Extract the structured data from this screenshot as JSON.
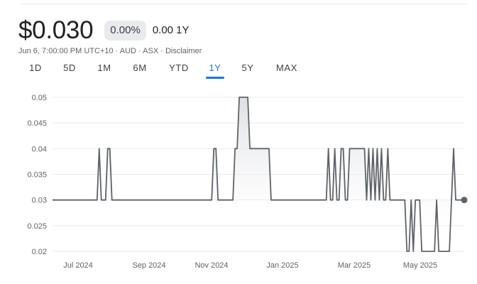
{
  "header": {
    "price": "$0.030",
    "change_percent": "0.00%",
    "change_abs": "0.00 1Y",
    "meta": "Jun 6, 7:00:00 PM UTC+10 · AUD · ASX · Disclaimer"
  },
  "range_tabs": {
    "items": [
      "1D",
      "5D",
      "1M",
      "6M",
      "YTD",
      "1Y",
      "5Y",
      "MAX"
    ],
    "selected": "1Y"
  },
  "colors": {
    "line": "#5f6368",
    "accent": "#1a73e8",
    "grid": "#e8eaed",
    "fill_top": "#dadce0"
  },
  "chart_data": {
    "type": "area",
    "xlabel": "",
    "ylabel": "",
    "ylim": [
      0.02,
      0.05
    ],
    "y_ticks": [
      "0.05",
      "0.045",
      "0.04",
      "0.035",
      "0.03",
      "0.025",
      "0.02"
    ],
    "y_tick_values": [
      0.05,
      0.045,
      0.04,
      0.035,
      0.03,
      0.025,
      0.02
    ],
    "x_ticks": [
      "Jul 2024",
      "Sep 2024",
      "Nov 2024",
      "Jan 2025",
      "Mar 2025",
      "May 2025"
    ],
    "grid": true,
    "series": [
      {
        "values": [
          0.03,
          0.03,
          0.03,
          0.03,
          0.03,
          0.03,
          0.03,
          0.03,
          0.03,
          0.03,
          0.03,
          0.03,
          0.03,
          0.03,
          0.03,
          0.03,
          0.03,
          0.03,
          0.03,
          0.03,
          0.03,
          0.03,
          0.04,
          0.03,
          0.03,
          0.03,
          0.04,
          0.04,
          0.03,
          0.03,
          0.03,
          0.03,
          0.03,
          0.03,
          0.03,
          0.03,
          0.03,
          0.03,
          0.03,
          0.03,
          0.03,
          0.03,
          0.03,
          0.03,
          0.03,
          0.03,
          0.03,
          0.03,
          0.03,
          0.03,
          0.03,
          0.03,
          0.03,
          0.03,
          0.03,
          0.03,
          0.03,
          0.03,
          0.03,
          0.03,
          0.03,
          0.03,
          0.03,
          0.03,
          0.03,
          0.03,
          0.03,
          0.03,
          0.03,
          0.03,
          0.03,
          0.03,
          0.03,
          0.03,
          0.03,
          0.03,
          0.04,
          0.04,
          0.03,
          0.03,
          0.03,
          0.03,
          0.03,
          0.03,
          0.03,
          0.03,
          0.04,
          0.04,
          0.05,
          0.05,
          0.05,
          0.05,
          0.05,
          0.04,
          0.04,
          0.04,
          0.04,
          0.04,
          0.04,
          0.04,
          0.04,
          0.04,
          0.04,
          0.03,
          0.03,
          0.03,
          0.03,
          0.03,
          0.03,
          0.03,
          0.03,
          0.03,
          0.03,
          0.03,
          0.03,
          0.03,
          0.03,
          0.03,
          0.03,
          0.03,
          0.03,
          0.03,
          0.03,
          0.03,
          0.03,
          0.03,
          0.03,
          0.03,
          0.03,
          0.03,
          0.04,
          0.03,
          0.03,
          0.04,
          0.03,
          0.03,
          0.04,
          0.04,
          0.03,
          0.03,
          0.04,
          0.04,
          0.04,
          0.04,
          0.04,
          0.04,
          0.04,
          0.04,
          0.03,
          0.04,
          0.03,
          0.04,
          0.03,
          0.04,
          0.03,
          0.04,
          0.03,
          0.03,
          0.04,
          0.03,
          0.03,
          0.03,
          0.03,
          0.03,
          0.03,
          0.03,
          0.03,
          0.02,
          0.02,
          0.03,
          0.02,
          0.03,
          0.03,
          0.03,
          0.02,
          0.02,
          0.02,
          0.02,
          0.02,
          0.02,
          0.02,
          0.03,
          0.02,
          0.02,
          0.02,
          0.02,
          0.02,
          0.02,
          0.03,
          0.04,
          0.03,
          0.03,
          0.03,
          0.03,
          0.03
        ]
      }
    ]
  }
}
